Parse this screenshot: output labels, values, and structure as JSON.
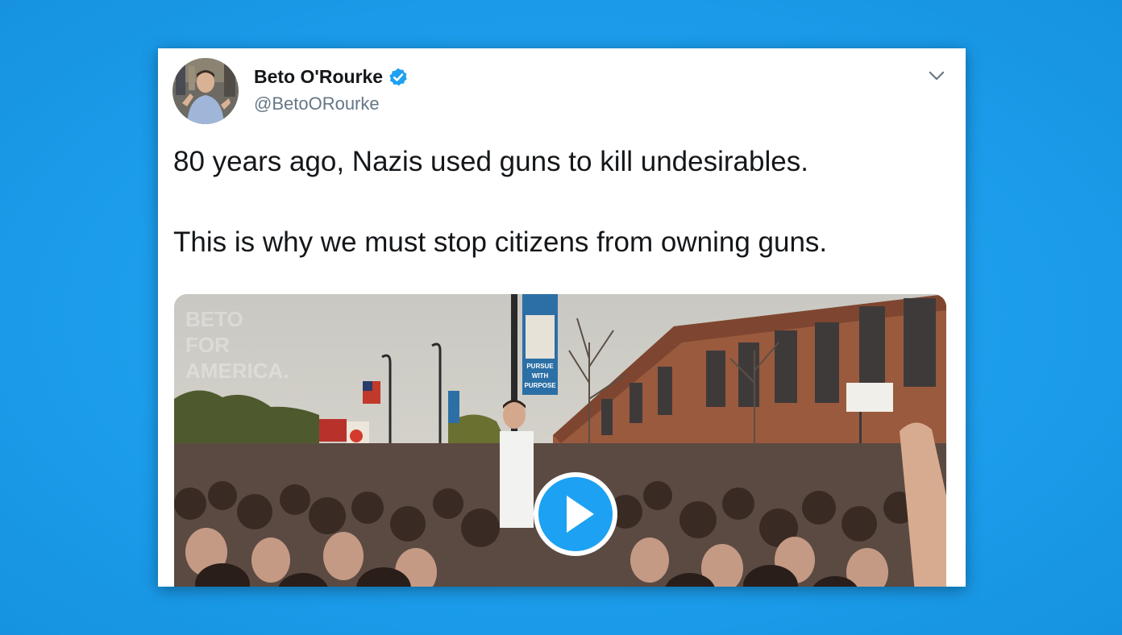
{
  "tweet": {
    "author": {
      "display_name": "Beto O'Rourke",
      "handle": "@BetoORourke",
      "verified": true
    },
    "text_line1": "80 years ago, Nazis used guns to kill undesirables.",
    "text_line2": "This is why we must stop citizens from owning guns.",
    "media": {
      "type": "video",
      "watermark_lines": [
        "BETO",
        "FOR",
        "AMERICA."
      ],
      "sign_text_lines": [
        "PURSUE",
        "WITH",
        "PURPOSE"
      ],
      "play_icon": "play-icon"
    },
    "menu_icon": "chevron-down-icon"
  },
  "colors": {
    "background": "#1da1f2",
    "card": "#ffffff",
    "verified_badge": "#1da1f2",
    "play_button": "#1da1f2",
    "name_text": "#14171a",
    "handle_text": "#657786"
  }
}
